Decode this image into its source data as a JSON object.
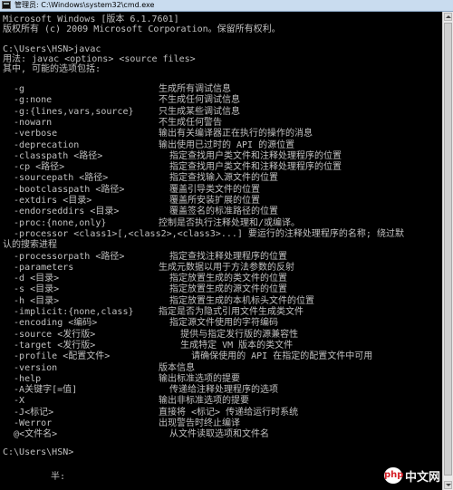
{
  "window": {
    "title": "管理员: C:\\Windows\\system32\\cmd.exe"
  },
  "header": {
    "version_line": "Microsoft Windows [版本 6.1.7601]",
    "copyright_line": "版权所有 (c) 2009 Microsoft Corporation。保留所有权利。",
    "prompt_command": "C:\\Users\\HSN>javac",
    "usage_line": "用法: javac <options> <source files>",
    "options_intro": "其中, 可能的选项包括:"
  },
  "options": [
    {
      "flag": "  -g",
      "desc": "生成所有调试信息"
    },
    {
      "flag": "  -g:none",
      "desc": "不生成任何调试信息"
    },
    {
      "flag": "  -g:{lines,vars,source}",
      "desc": "只生成某些调试信息"
    },
    {
      "flag": "  -nowarn",
      "desc": "不生成任何警告"
    },
    {
      "flag": "  -verbose",
      "desc": "输出有关编译器正在执行的操作的消息"
    },
    {
      "flag": "  -deprecation",
      "desc": "输出使用已过时的 API 的源位置"
    },
    {
      "flag": "  -classpath <路径>",
      "desc": "  指定查找用户类文件和注释处理程序的位置"
    },
    {
      "flag": "  -cp <路径>",
      "desc": "  指定查找用户类文件和注释处理程序的位置"
    },
    {
      "flag": "  -sourcepath <路径>",
      "desc": "  指定查找输入源文件的位置"
    },
    {
      "flag": "  -bootclasspath <路径>",
      "desc": "  覆盖引导类文件的位置"
    },
    {
      "flag": "  -extdirs <目录>",
      "desc": "  覆盖所安装扩展的位置"
    },
    {
      "flag": "  -endorseddirs <目录>",
      "desc": "  覆盖签名的标准路径的位置"
    },
    {
      "flag": "  -proc:{none,only}",
      "desc": "控制是否执行注释处理和/或编译。"
    },
    {
      "flag": "  -processor <class1>[,<class2>,<class3>...] 要运行的注释处理程序的名称; 绕过默",
      "desc": ""
    },
    {
      "flag": "认的搜索进程",
      "desc": ""
    },
    {
      "flag": "  -processorpath <路径>",
      "desc": "  指定查找注释处理程序的位置"
    },
    {
      "flag": "  -parameters",
      "desc": "生成元数据以用于方法参数的反射"
    },
    {
      "flag": "  -d <目录>",
      "desc": "  指定放置生成的类文件的位置"
    },
    {
      "flag": "  -s <目录>",
      "desc": "  指定放置生成的源文件的位置"
    },
    {
      "flag": "  -h <目录>",
      "desc": "  指定放置生成的本机标头文件的位置"
    },
    {
      "flag": "  -implicit:{none,class}",
      "desc": "指定是否为隐式引用文件生成类文件"
    },
    {
      "flag": "  -encoding <编码>",
      "desc": "  指定源文件使用的字符编码"
    },
    {
      "flag": "  -source <发行版>",
      "desc": "    提供与指定发行版的源兼容性"
    },
    {
      "flag": "  -target <发行版>",
      "desc": "    生成特定 VM 版本的类文件"
    },
    {
      "flag": "  -profile <配置文件>",
      "desc": "      请确保使用的 API 在指定的配置文件中可用"
    },
    {
      "flag": "  -version",
      "desc": "版本信息"
    },
    {
      "flag": "  -help",
      "desc": "输出标准选项的提要"
    },
    {
      "flag": "  -A关键字[=值]",
      "desc": "  传递给注释处理程序的选项"
    },
    {
      "flag": "  -X",
      "desc": "输出非标准选项的提要"
    },
    {
      "flag": "  -J<标记>",
      "desc": "直接将 <标记> 传递给运行时系统"
    },
    {
      "flag": "  -Werror",
      "desc": "出现警告时终止编译"
    },
    {
      "flag": "  @<文件名>",
      "desc": "  从文件读取选项和文件名"
    }
  ],
  "footer": {
    "prompt": "C:\\Users\\HSN>",
    "ime_status": "半:"
  },
  "watermark": {
    "logo_text": "php",
    "site_text": "中文网"
  }
}
